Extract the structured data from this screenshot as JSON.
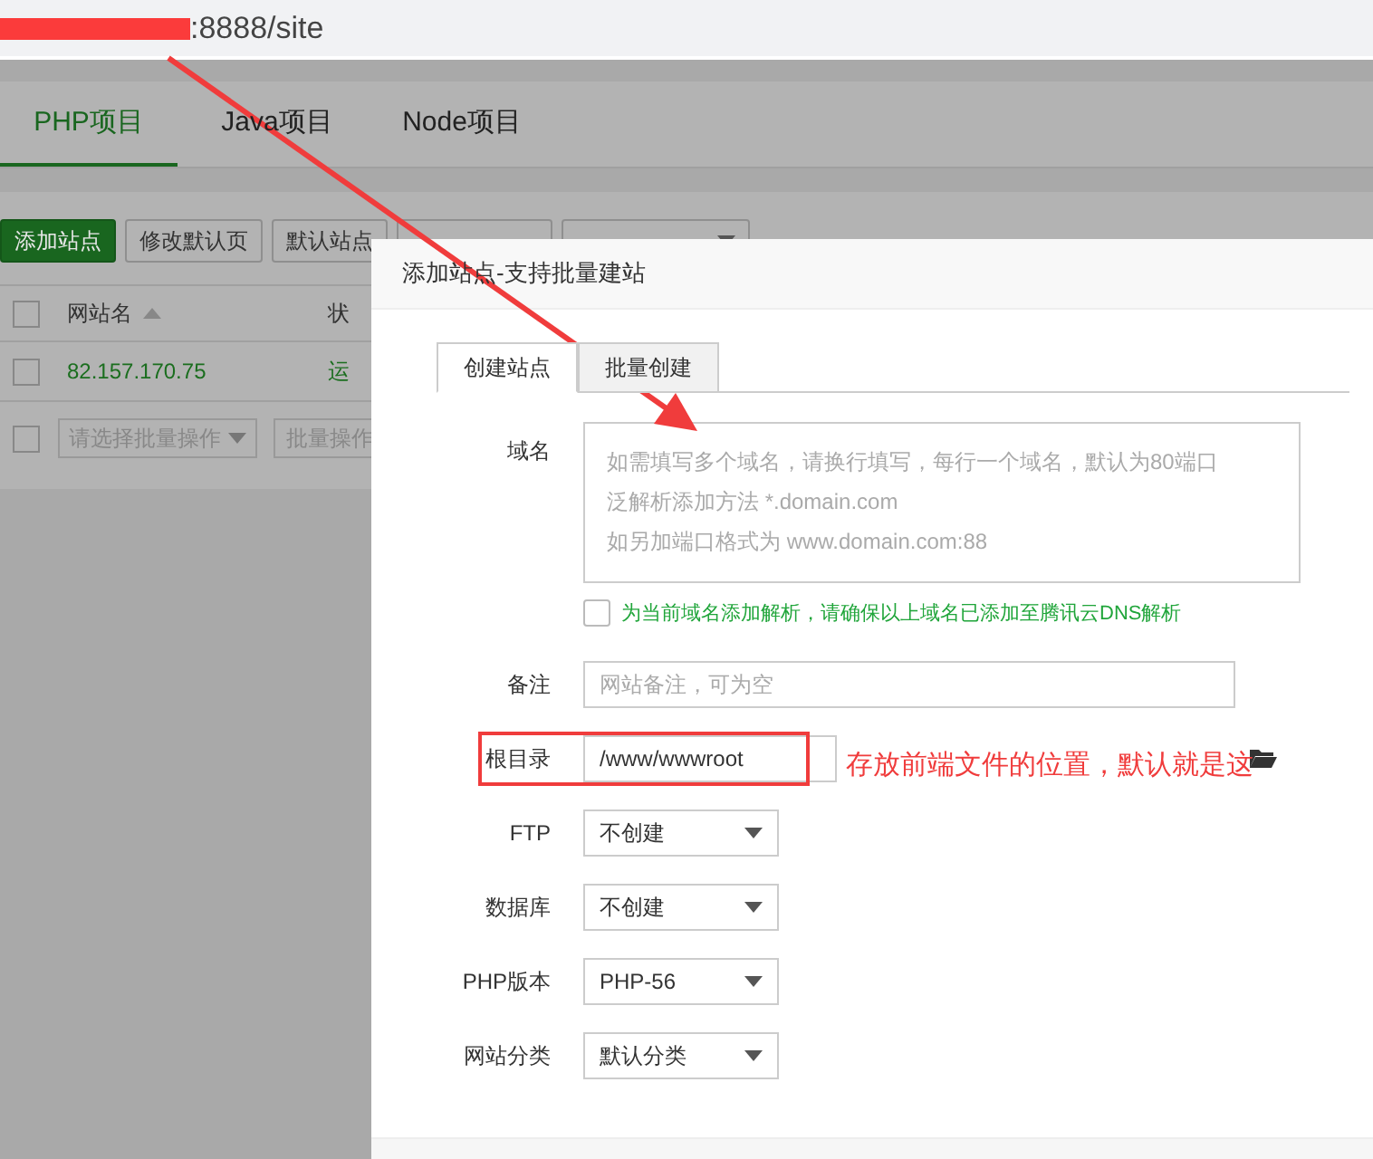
{
  "address_bar": {
    "url_tail": ":8888/site"
  },
  "project_tabs": [
    {
      "label": "PHP项目",
      "selected": true
    },
    {
      "label": "Java项目",
      "selected": false
    },
    {
      "label": "Node项目",
      "selected": false
    }
  ],
  "toolbar": [
    {
      "label": "添加站点",
      "kind": "primary"
    },
    {
      "label": "修改默认页",
      "kind": "plain"
    },
    {
      "label": "默认站点",
      "kind": "plain"
    },
    {
      "kind": "plain"
    },
    {
      "kind": "dropdown"
    }
  ],
  "table": {
    "all_checked": false,
    "columns": [
      {
        "label": "网站名",
        "sorted": true
      },
      {
        "label": "状",
        "sorted": false
      }
    ],
    "rows": [
      {
        "checked": false,
        "cells": [
          "82.157.170.75",
          "运"
        ]
      }
    ]
  },
  "batch": {
    "checked": false,
    "placeholder": "请选择批量操作",
    "button": "批量操作"
  },
  "dialog": {
    "title": "添加站点-支持批量建站",
    "tabs": [
      {
        "label": "创建站点",
        "selected": true
      },
      {
        "label": "批量创建",
        "selected": false
      }
    ],
    "fields": [
      {
        "kind": "textarea",
        "label": "域名",
        "placeholder": [
          "如需填写多个域名，请换行填写，每行一个域名，默认为80端口",
          "泛解析添加方法 *.domain.com",
          "如另加端口格式为 www.domain.com:88"
        ]
      },
      {
        "kind": "checkbox",
        "label": "为当前域名添加解析，请确保以上域名已添加至腾讯云DNS解析",
        "checked": false
      },
      {
        "kind": "text",
        "label": "备注",
        "placeholder": "网站备注，可为空"
      },
      {
        "kind": "path",
        "label": "根目录",
        "value": "/www/wwwroot"
      },
      {
        "kind": "select",
        "label": "FTP",
        "value": "不创建"
      },
      {
        "kind": "select",
        "label": "数据库",
        "value": "不创建"
      },
      {
        "kind": "select",
        "label": "PHP版本",
        "value": "PHP-56"
      },
      {
        "kind": "select",
        "label": "网站分类",
        "value": "默认分类"
      }
    ]
  },
  "annotation": {
    "note": "存放前端文件的位置，默认就是这"
  }
}
